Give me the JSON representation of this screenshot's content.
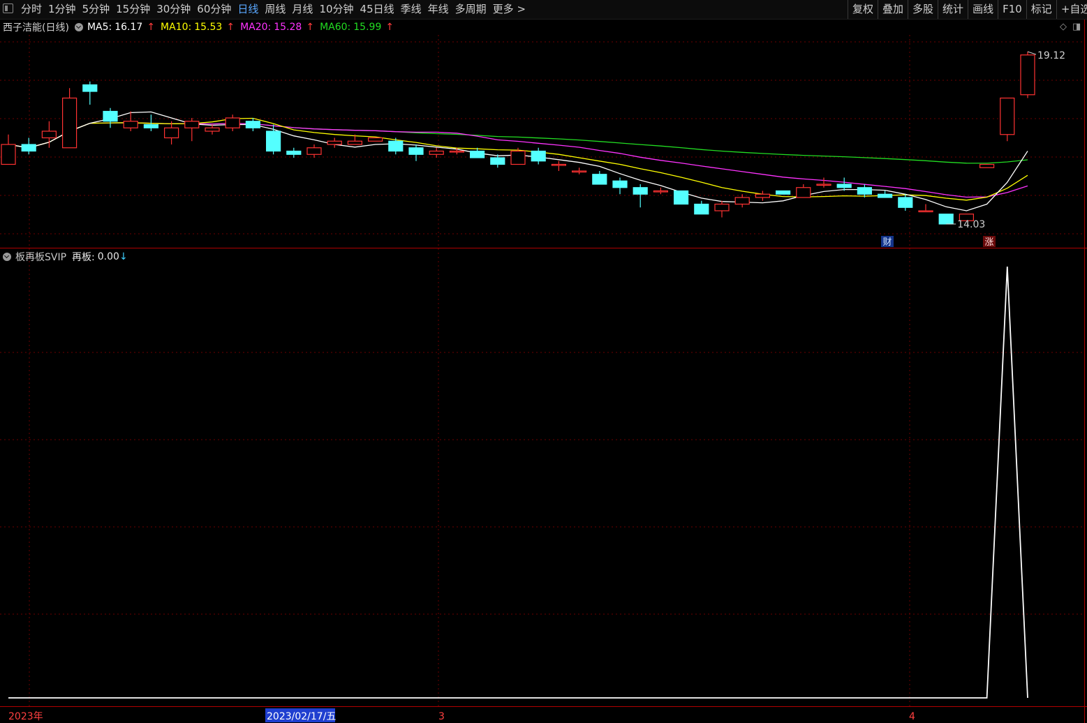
{
  "toolbar": {
    "periods": [
      "分时",
      "1分钟",
      "5分钟",
      "15分钟",
      "30分钟",
      "60分钟",
      "日线",
      "周线",
      "月线",
      "10分钟",
      "45日线",
      "季线",
      "年线",
      "多周期",
      "更多 >"
    ],
    "active_period": "日线",
    "right_buttons": [
      "复权",
      "叠加",
      "多股",
      "统计",
      "画线",
      "F10",
      "标记",
      "+自选"
    ]
  },
  "main_pane": {
    "title": "西子洁能(日线)",
    "ma": [
      {
        "label": "MA5:",
        "value": "16.17",
        "color": "#ffffff",
        "arrow": "↑"
      },
      {
        "label": "MA10:",
        "value": "15.53",
        "color": "#ffff00",
        "arrow": "↑"
      },
      {
        "label": "MA20:",
        "value": "15.28",
        "color": "#ff33ff",
        "arrow": "↑"
      },
      {
        "label": "MA60:",
        "value": "15.99",
        "color": "#22dd22",
        "arrow": "↑"
      }
    ],
    "high_label": "19.12",
    "low_label": "14.03",
    "markers": [
      "财",
      "涨"
    ]
  },
  "sub_pane": {
    "name": "板再板SVIP",
    "label": "再板:",
    "value": "0.00",
    "arrow": "↓"
  },
  "x_axis_labels": [
    "2023年",
    "2023/02/17/五",
    "3",
    "4"
  ],
  "colors": {
    "background": "#000000",
    "grid": "#6e0000",
    "up_candle": "#ff3232",
    "down_candle": "#54ffff",
    "ma5": "#ffffff",
    "ma10": "#ffff00",
    "ma20": "#ff33ff",
    "ma60": "#22dd22",
    "indicator": "#ffffff",
    "date_highlight_bg": "#1f3fd0"
  },
  "chart_data": [
    {
      "type": "candlestick",
      "title": "西子洁能(日线)",
      "y_range": [
        13.6,
        19.6
      ],
      "series_order": [
        "open",
        "close",
        "high",
        "low"
      ],
      "ohlc": [
        [
          15.8,
          16.4,
          16.7,
          15.8
        ],
        [
          16.4,
          16.2,
          16.6,
          16.1
        ],
        [
          16.6,
          16.8,
          17.1,
          16.3
        ],
        [
          16.3,
          17.8,
          18.1,
          16.3
        ],
        [
          18.2,
          18.0,
          18.3,
          17.6
        ],
        [
          17.4,
          17.1,
          17.5,
          16.9
        ],
        [
          16.9,
          17.1,
          17.4,
          16.8
        ],
        [
          17.0,
          16.9,
          17.3,
          16.8
        ],
        [
          16.6,
          16.9,
          17.1,
          16.4
        ],
        [
          16.9,
          17.1,
          17.2,
          16.5
        ],
        [
          16.8,
          16.9,
          17.0,
          16.7
        ],
        [
          16.9,
          17.2,
          17.3,
          16.8
        ],
        [
          17.1,
          16.9,
          17.2,
          16.8
        ],
        [
          16.8,
          16.2,
          17.0,
          16.1
        ],
        [
          16.2,
          16.1,
          16.3,
          16.0
        ],
        [
          16.1,
          16.3,
          16.4,
          16.0
        ],
        [
          16.4,
          16.5,
          16.6,
          16.3
        ],
        [
          16.4,
          16.5,
          16.7,
          16.4
        ],
        [
          16.5,
          16.6,
          16.6,
          16.5
        ],
        [
          16.5,
          16.2,
          16.6,
          16.1
        ],
        [
          16.3,
          16.1,
          16.4,
          15.9
        ],
        [
          16.1,
          16.2,
          16.3,
          16.0
        ],
        [
          16.2,
          16.2,
          16.3,
          16.1
        ],
        [
          16.2,
          16.0,
          16.3,
          16.0
        ],
        [
          16.0,
          15.8,
          16.1,
          15.7
        ],
        [
          15.8,
          16.2,
          16.3,
          15.8
        ],
        [
          16.2,
          15.9,
          16.3,
          15.8
        ],
        [
          15.8,
          15.8,
          15.9,
          15.6
        ],
        [
          15.6,
          15.6,
          15.7,
          15.5
        ],
        [
          15.5,
          15.2,
          15.6,
          15.2
        ],
        [
          15.3,
          15.1,
          15.4,
          14.9
        ],
        [
          15.1,
          14.9,
          15.2,
          14.5
        ],
        [
          15.0,
          15.0,
          15.1,
          14.9
        ],
        [
          15.0,
          14.6,
          15.0,
          14.6
        ],
        [
          14.6,
          14.3,
          14.7,
          14.3
        ],
        [
          14.4,
          14.6,
          14.7,
          14.2
        ],
        [
          14.6,
          14.8,
          14.9,
          14.5
        ],
        [
          14.8,
          14.9,
          15.0,
          14.7
        ],
        [
          15.0,
          14.9,
          15.0,
          14.9
        ],
        [
          14.8,
          15.1,
          15.2,
          14.8
        ],
        [
          15.2,
          15.2,
          15.4,
          15.1
        ],
        [
          15.2,
          15.1,
          15.4,
          15.0
        ],
        [
          15.1,
          14.9,
          15.2,
          14.8
        ],
        [
          14.9,
          14.8,
          15.0,
          14.8
        ],
        [
          14.8,
          14.5,
          14.9,
          14.4
        ],
        [
          14.4,
          14.4,
          14.6,
          14.4
        ],
        [
          14.3,
          14.0,
          14.3,
          14.0
        ],
        [
          14.1,
          14.3,
          14.3,
          14.1
        ],
        [
          15.7,
          15.8,
          15.8,
          15.7
        ],
        [
          16.7,
          17.8,
          17.8,
          16.5
        ],
        [
          17.9,
          19.1,
          19.2,
          17.8
        ]
      ]
    },
    {
      "type": "line",
      "title": "板再板SVIP",
      "series": [
        {
          "name": "再板",
          "values": [
            0,
            0,
            0,
            0,
            0,
            0,
            0,
            0,
            0,
            0,
            0,
            0,
            0,
            0,
            0,
            0,
            0,
            0,
            0,
            0,
            0,
            0,
            0,
            0,
            0,
            0,
            0,
            0,
            0,
            0,
            0,
            0,
            0,
            0,
            0,
            0,
            0,
            0,
            0,
            0,
            0,
            0,
            0,
            0,
            0,
            0,
            0,
            0,
            0,
            1,
            0
          ]
        }
      ],
      "y_range": [
        0,
        1
      ]
    }
  ]
}
